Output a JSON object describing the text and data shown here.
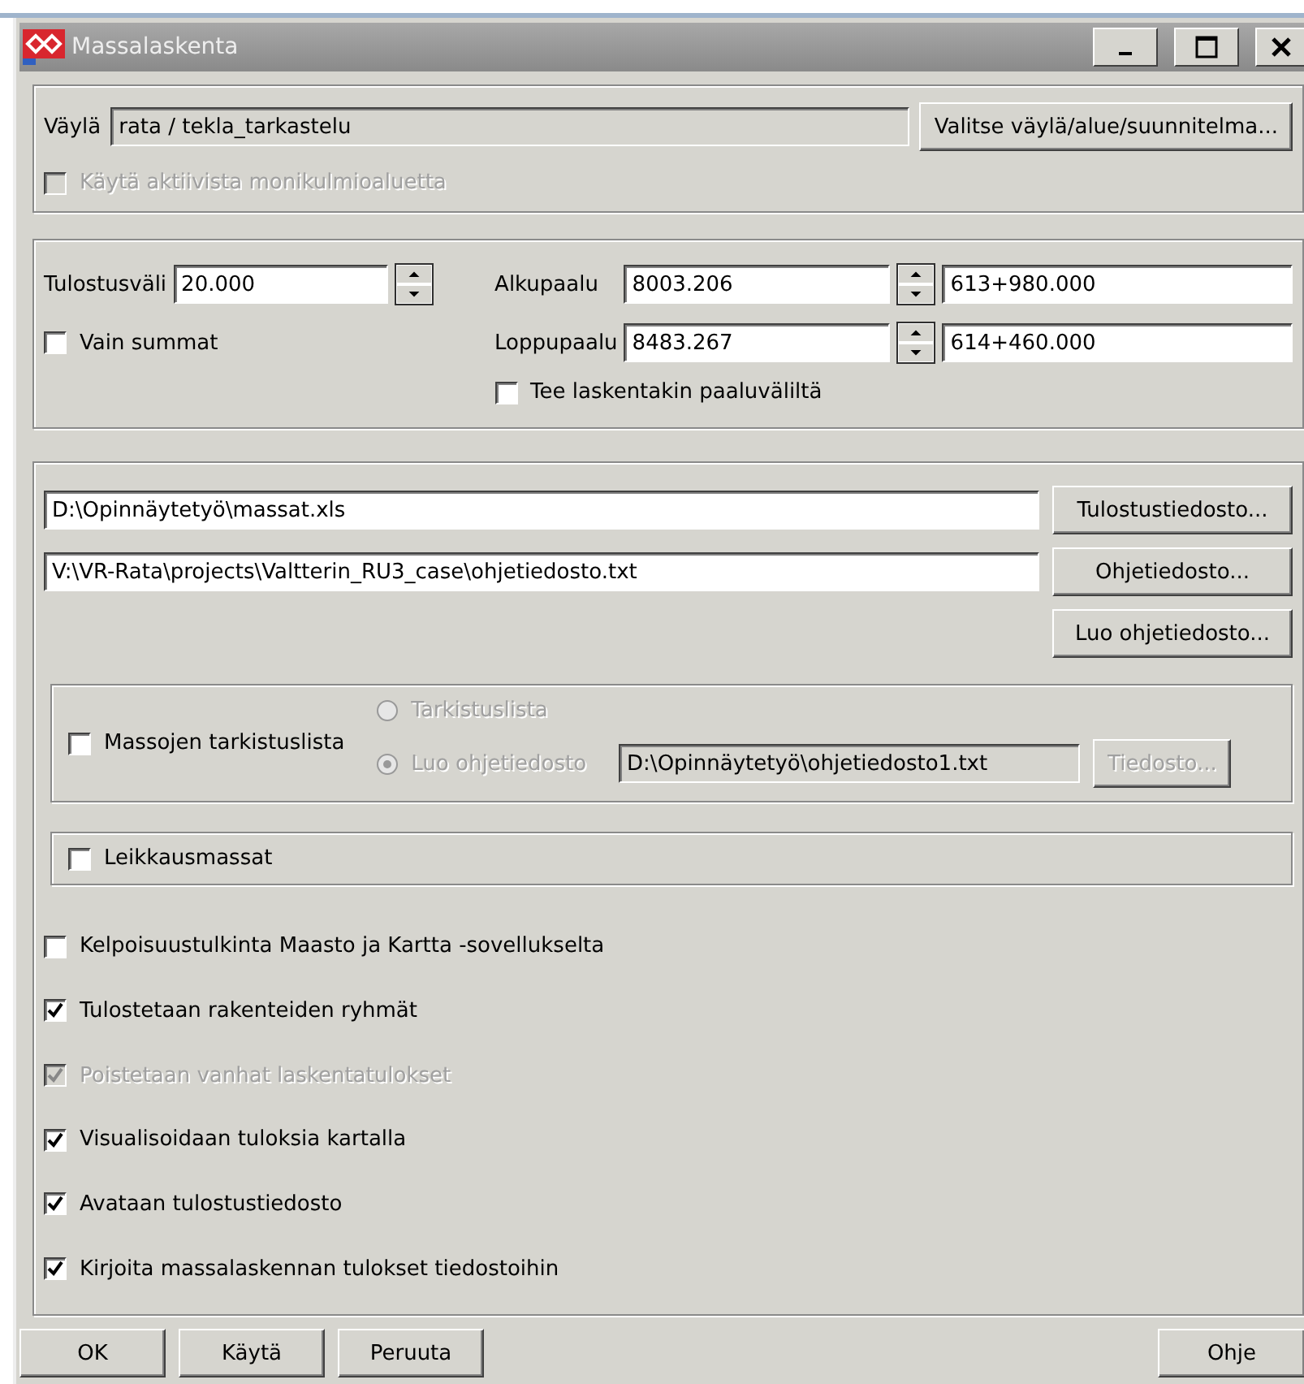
{
  "window": {
    "title": "Massalaskenta"
  },
  "route": {
    "label": "Väylä",
    "value": "rata / tekla_tarkastelu",
    "button": "Valitse väylä/alue/suunnitelma..."
  },
  "polygon_option": {
    "label": "Käytä aktiivista monikulmioaluetta",
    "checked": false,
    "disabled": true
  },
  "interval": {
    "label": "Tulostusväli",
    "value": "20.000"
  },
  "only_sums": {
    "label": "Vain summat",
    "checked": false,
    "disabled": false
  },
  "stations": [
    {
      "label": "Alkupaalu",
      "value": "8003.206",
      "station": "613+980.000"
    },
    {
      "label": "Loppupaalu",
      "value": "8483.267",
      "station": "614+460.000"
    }
  ],
  "pile_option": {
    "label": "Tee laskentakin paaluväliltä",
    "checked": false,
    "disabled": false
  },
  "files": [
    {
      "value": "D:\\Opinnäytetyö\\massat.xls",
      "button": "Tulostustiedosto..."
    },
    {
      "value": "V:\\VR-Rata\\projects\\Valtterin_RU3_case\\ohjetiedosto.txt",
      "button": "Ohjetiedosto..."
    }
  ],
  "create_button": "Luo ohjetiedosto...",
  "check_list": {
    "checkbox": {
      "label": "Massojen tarkistuslista",
      "checked": false,
      "disabled": false
    },
    "radios": [
      {
        "label": "Tarkistuslista",
        "selected": false,
        "disabled": true
      },
      {
        "label": "Luo ohjetiedosto",
        "selected": true,
        "disabled": true
      }
    ],
    "file": "D:\\Opinnäytetyö\\ohjetiedosto1.txt",
    "button": {
      "label": "Tiedosto...",
      "disabled": true
    }
  },
  "cut_masses": {
    "label": "Leikkausmassat",
    "checked": false,
    "disabled": false
  },
  "options": [
    {
      "label": "Kelpoisuustulkinta Maasto ja Kartta -sovellukselta",
      "checked": false,
      "disabled": false
    },
    {
      "label": "Tulostetaan rakenteiden ryhmät",
      "checked": true,
      "disabled": false
    },
    {
      "label": "Poistetaan vanhat laskentatulokset",
      "checked": true,
      "disabled": true
    },
    {
      "label": "Visualisoidaan tuloksia kartalla",
      "checked": true,
      "disabled": false
    },
    {
      "label": "Avataan tulostustiedosto",
      "checked": true,
      "disabled": false
    },
    {
      "label": "Kirjoita massalaskennan tulokset tiedostoihin",
      "checked": true,
      "disabled": false
    }
  ],
  "buttons": [
    "OK",
    "Käytä",
    "Peruuta"
  ],
  "help_button": "Ohje"
}
